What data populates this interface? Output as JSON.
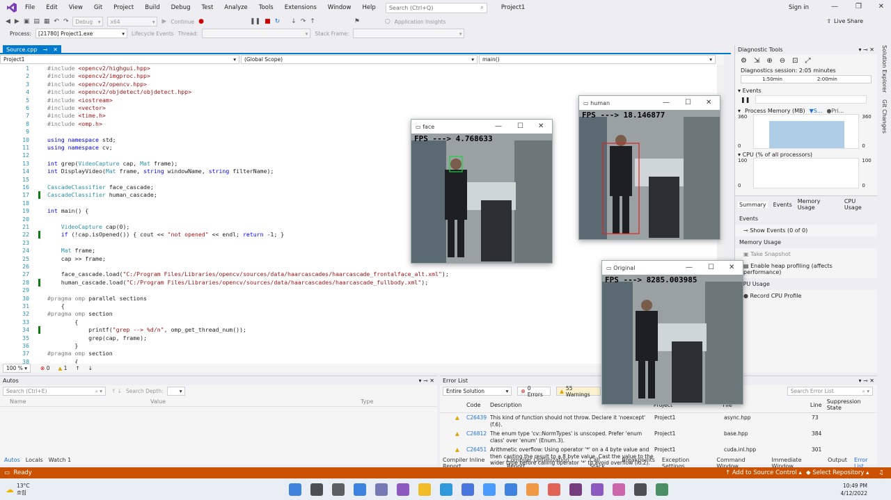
{
  "menu": {
    "items": [
      "File",
      "Edit",
      "View",
      "Git",
      "Project",
      "Build",
      "Debug",
      "Test",
      "Analyze",
      "Tools",
      "Extensions",
      "Window",
      "Help"
    ],
    "search_placeholder": "Search (Ctrl+Q)",
    "project_title": "Project1",
    "sign_in": "Sign in",
    "live_share": "Live Share"
  },
  "toolbar": {
    "config": "Debug",
    "platform": "x64",
    "continue": "Continue",
    "app_insights": "Application Insights"
  },
  "debug_location": {
    "process_label": "Process:",
    "process_value": "[21780] Project1.exe",
    "lifecycle": "Lifecycle Events",
    "thread": "Thread:",
    "stack": "Stack Frame:"
  },
  "editor": {
    "tab": "Source.cpp",
    "nav_project": "Project1",
    "nav_scope": "(Global Scope)",
    "nav_func": "main()",
    "zoom": "100 %",
    "errors": "0",
    "warnings": "1"
  },
  "code": [
    {
      "n": "1",
      "t": "#include <opencv2/highgui.hpp>",
      "k": "inc"
    },
    {
      "n": "2",
      "t": "#include <opencv2/imgproc.hpp>",
      "k": "inc"
    },
    {
      "n": "3",
      "t": "#include <opencv2/opencv.hpp>",
      "k": "inc"
    },
    {
      "n": "4",
      "t": "#include <opencv2/objdetect/objdetect.hpp>",
      "k": "inc"
    },
    {
      "n": "5",
      "t": "#include <iostream>",
      "k": "inc"
    },
    {
      "n": "6",
      "t": "#include <vector>",
      "k": "inc"
    },
    {
      "n": "7",
      "t": "#include <time.h>",
      "k": "inc"
    },
    {
      "n": "8",
      "t": "#include <omp.h>",
      "k": "inc"
    },
    {
      "n": "9",
      "t": "",
      "k": "plain"
    },
    {
      "n": "10",
      "t": "using namespace std;",
      "k": "using"
    },
    {
      "n": "11",
      "t": "using namespace cv;",
      "k": "using"
    },
    {
      "n": "12",
      "t": "",
      "k": "plain"
    },
    {
      "n": "13",
      "t": "int grep(VideoCapture cap, Mat frame);",
      "k": "plain"
    },
    {
      "n": "14",
      "t": "int DisplayVideo(Mat frame, string windowName, string filterName);",
      "k": "plain"
    },
    {
      "n": "15",
      "t": "",
      "k": "plain"
    },
    {
      "n": "16",
      "t": "CascadeClassifier face_cascade;",
      "k": "plain"
    },
    {
      "n": "17",
      "t": "CascadeClassifier human_cascade;",
      "k": "plain",
      "chg": true
    },
    {
      "n": "18",
      "t": "",
      "k": "plain"
    },
    {
      "n": "19",
      "t": "int main() {",
      "k": "plain"
    },
    {
      "n": "20",
      "t": "",
      "k": "plain"
    },
    {
      "n": "21",
      "t": "    VideoCapture cap(0);",
      "k": "plain"
    },
    {
      "n": "22",
      "t": "    if (!cap.isOpened()) { cout << \"not opened\" << endl; return -1; }",
      "k": "plain",
      "chg": true
    },
    {
      "n": "23",
      "t": "",
      "k": "plain"
    },
    {
      "n": "24",
      "t": "    Mat frame;",
      "k": "plain"
    },
    {
      "n": "25",
      "t": "    cap >> frame;",
      "k": "plain"
    },
    {
      "n": "26",
      "t": "",
      "k": "plain"
    },
    {
      "n": "27",
      "t": "    face_cascade.load(\"C:/Program Files/Libraries/opencv/sources/data/haarcascades/haarcascade_frontalface_alt.xml\");",
      "k": "plain"
    },
    {
      "n": "28",
      "t": "    human_cascade.load(\"C:/Program Files/Libraries/opencv/sources/data/haarcascades/haarcascade_fullbody.xml\");",
      "k": "plain",
      "chg": true
    },
    {
      "n": "29",
      "t": "",
      "k": "plain"
    },
    {
      "n": "30",
      "t": "#pragma omp parallel sections",
      "k": "pragma"
    },
    {
      "n": "31",
      "t": "    {",
      "k": "plain"
    },
    {
      "n": "32",
      "t": "#pragma omp section",
      "k": "pragma"
    },
    {
      "n": "33",
      "t": "        {",
      "k": "plain"
    },
    {
      "n": "34",
      "t": "            printf(\"grep --> %d/n\", omp_get_thread_num());",
      "k": "plain",
      "chg": true
    },
    {
      "n": "35",
      "t": "            grep(cap, frame);",
      "k": "plain"
    },
    {
      "n": "36",
      "t": "        }",
      "k": "plain"
    },
    {
      "n": "37",
      "t": "#pragma omp section",
      "k": "pragma"
    },
    {
      "n": "38",
      "t": "        {",
      "k": "plain"
    }
  ],
  "diag": {
    "title": "Diagnostic Tools",
    "session": "Diagnostics session: 2:05 minutes",
    "t1": "1:50min",
    "t2": "2:00min",
    "events": "Events",
    "memory": "Process Memory (MB)",
    "mem_legend1": "S...",
    "mem_legend2": "Pri...",
    "mem_max": "360",
    "mem_min": "0",
    "mem_fill": 0.82,
    "cpu": "CPU (% of all processors)",
    "cpu_max": "100",
    "cpu_min": "0",
    "tabs": [
      "Summary",
      "Events",
      "Memory Usage",
      "CPU Usage"
    ],
    "sec_events": "Events",
    "show_events": "Show Events (0 of 0)",
    "sec_memory": "Memory Usage",
    "take_snapshot": "Take Snapshot",
    "heap": "Enable heap profiling (affects performance)",
    "sec_cpu": "CPU Usage",
    "record_cpu": "Record CPU Profile"
  },
  "side_tabs": [
    "Solution Explorer",
    "Git Changes"
  ],
  "autos": {
    "title": "Autos",
    "search": "Search (Ctrl+E)",
    "depth": "Search Depth:",
    "cols": [
      "Name",
      "Value",
      "Type"
    ],
    "tabs": [
      "Autos",
      "Locals",
      "Watch 1"
    ]
  },
  "errors": {
    "title": "Error List",
    "scope": "Entire Solution",
    "errors_btn": "0 Errors",
    "warnings_btn": "55 Warnings",
    "search": "Search Error List",
    "cols": [
      "Code",
      "Description",
      "Project",
      "File",
      "Line",
      "Suppression State"
    ],
    "rows": [
      {
        "code": "C26439",
        "desc": "This kind of function should not throw. Declare it 'noexcept' (f.6).",
        "project": "Project1",
        "file": "async.hpp",
        "line": "73"
      },
      {
        "code": "C26812",
        "desc": "The enum type 'cv::NormTypes' is unscoped. Prefer 'enum class' over 'enum' (Enum.3).",
        "project": "Project1",
        "file": "base.hpp",
        "line": "384"
      },
      {
        "code": "C26451",
        "desc": "Arithmetic overflow: Using operator '*' on a 4 byte value and then casting the result to a 8 byte value. Cast the value to the wider type before calling operator '*' to avoid overflow (io.2).",
        "project": "Project1",
        "file": "cuda.inl.hpp",
        "line": "301"
      }
    ],
    "tabs": [
      "Compiler Inline Report",
      "Compiler Optimization Report",
      "Call Stack",
      "Breakpoints",
      "Exception Settings",
      "Command Window",
      "Immediate Window",
      "Output",
      "Error List"
    ]
  },
  "status": {
    "ready": "Ready",
    "source_control": "Add to Source Control",
    "repo": "Select Repository"
  },
  "taskbar": {
    "temp": "13°C",
    "weather": "흐림",
    "time": "10:49 PM",
    "date": "4/12/2022"
  },
  "windows": {
    "face": {
      "title": "face",
      "fps": "FPS ---> 4.768633"
    },
    "human": {
      "title": "human",
      "fps": "FPS ---> 18.146877"
    },
    "original": {
      "title": "Original",
      "fps": "FPS ---> 8285.003985"
    }
  }
}
